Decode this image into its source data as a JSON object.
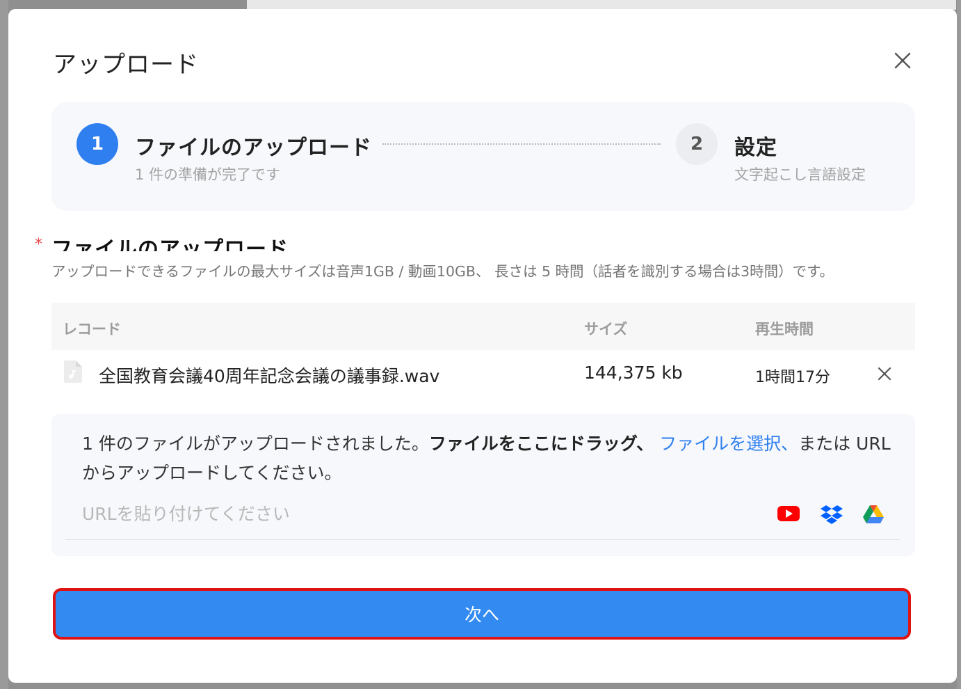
{
  "modal": {
    "title": "アップロード"
  },
  "steps": [
    {
      "number": "1",
      "title": "ファイルのアップロード",
      "subtitle": "1 件の準備が完了です"
    },
    {
      "number": "2",
      "title": "設定",
      "subtitle": "文字起こし言語設定"
    }
  ],
  "section": {
    "required_mark": "*",
    "title": "ファイルのアップロード",
    "description": "アップロードできるファイルの最大サイズは音声1GB / 動画10GB、 長さは 5 時間（話者を識別する場合は3時間）です。"
  },
  "table": {
    "headers": [
      "レコード",
      "サイズ",
      "再生時間"
    ],
    "rows": [
      {
        "name": "全国教育会議40周年記念会議の議事録.wav",
        "size": "144,375 kb",
        "duration": "1時間17分"
      }
    ]
  },
  "dropzone": {
    "text_prefix": "1 件のファイルがアップロードされました。",
    "text_bold": "ファイルをここにドラッグ、",
    "select_link": "ファイルを選択、",
    "text_suffix": "または URLからアップロードしてください。",
    "url_placeholder": "URLを貼り付けてください",
    "services": [
      "youtube-icon",
      "dropbox-icon",
      "google-drive-icon"
    ]
  },
  "buttons": {
    "next_label": "次へ"
  },
  "colors": {
    "accent": "#2f7ff0",
    "button": "#338bf2",
    "highlight_border": "#e01313"
  }
}
